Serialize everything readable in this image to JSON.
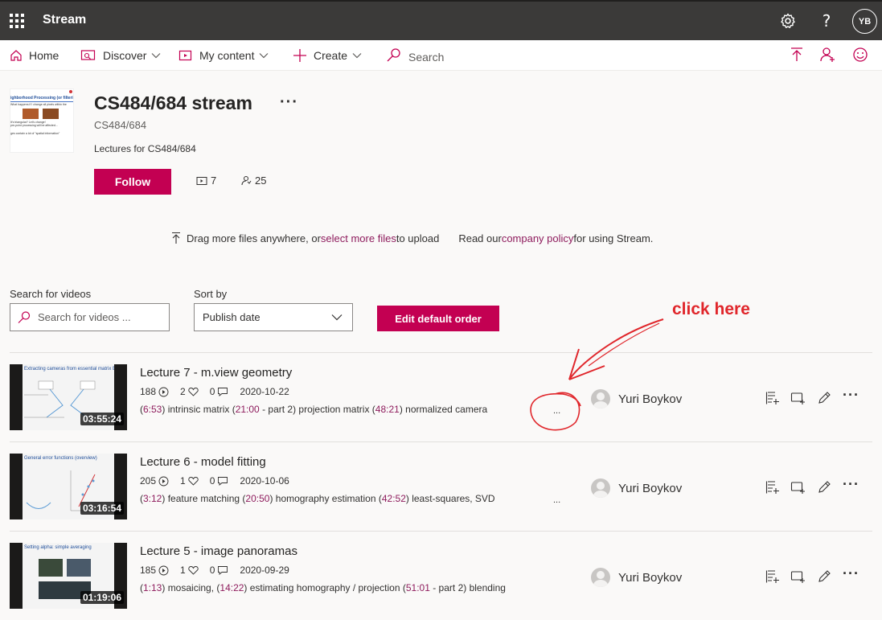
{
  "app": {
    "name": "Stream",
    "user_initials": "YB"
  },
  "nav": {
    "home": "Home",
    "discover": "Discover",
    "my_content": "My content",
    "create": "Create",
    "search": "Search"
  },
  "channel": {
    "title": "CS484/684 stream",
    "more": "···",
    "subtitle": "CS484/684",
    "description": "Lectures for CS484/684",
    "follow_label": "Follow",
    "video_count": "7",
    "follower_count": "25",
    "thumb_heading": "ighborhood Processing (or filtering)",
    "thumb_lines": [
      "What happens if I change all pixels within the",
      "It's triangular? Let's change!",
      "pre-point processing will be affected...",
      "ges contain a lot of \"spatial information\""
    ]
  },
  "upload": {
    "text1": "Drag more files anywhere, or ",
    "link1": "select more files",
    "text2": " to upload",
    "text3": "Read our ",
    "link2": "company policy",
    "text4": " for using Stream."
  },
  "controls": {
    "search_label": "Search for videos",
    "search_placeholder": "Search for videos ...",
    "sort_label": "Sort by",
    "sort_value": "Publish date",
    "edit_order_label": "Edit default order"
  },
  "annotation": {
    "text": "click here"
  },
  "videos": [
    {
      "title": "Lecture 7 - m.view geometry",
      "views": "188",
      "likes": "2",
      "comments": "0",
      "date": "2020-10-22",
      "duration": "03:55:24",
      "desc": [
        {
          "t": "(",
          "ts": false
        },
        {
          "t": "6:53",
          "ts": true
        },
        {
          "t": ") intrinsic matrix (",
          "ts": false
        },
        {
          "t": "21:00",
          "ts": true
        },
        {
          "t": " - part 2) projection matrix (",
          "ts": false
        },
        {
          "t": "48:21",
          "ts": true
        },
        {
          "t": ") normalized camera",
          "ts": false
        }
      ],
      "owner": "Yuri Boykov",
      "slide_title": "Extracting cameras from essential matrix E"
    },
    {
      "title": "Lecture 6 - model fitting",
      "views": "205",
      "likes": "1",
      "comments": "0",
      "date": "2020-10-06",
      "duration": "03:16:54",
      "desc": [
        {
          "t": "(",
          "ts": false
        },
        {
          "t": "3:12",
          "ts": true
        },
        {
          "t": ") feature matching (",
          "ts": false
        },
        {
          "t": "20:50",
          "ts": true
        },
        {
          "t": ") homography estimation (",
          "ts": false
        },
        {
          "t": "42:52",
          "ts": true
        },
        {
          "t": ") least-squares, SVD",
          "ts": false
        }
      ],
      "owner": "Yuri Boykov",
      "slide_title": "General error functions (overview)"
    },
    {
      "title": "Lecture 5 - image panoramas",
      "views": "185",
      "likes": "1",
      "comments": "0",
      "date": "2020-09-29",
      "duration": "01:19:06",
      "desc": [
        {
          "t": "(",
          "ts": false
        },
        {
          "t": "1:13",
          "ts": true
        },
        {
          "t": ") mosaicing, (",
          "ts": false
        },
        {
          "t": "14:22",
          "ts": true
        },
        {
          "t": ") estimating homography / projection (",
          "ts": false
        },
        {
          "t": "51:01",
          "ts": true
        },
        {
          "t": " - part 2) blending",
          "ts": false
        }
      ],
      "owner": "Yuri Boykov",
      "slide_title": "Setting alpha: simple averaging"
    }
  ],
  "icons": {
    "settings": "gear-icon",
    "help": "help-icon",
    "upload": "upload-icon",
    "invite": "add-person-icon",
    "feedback": "smiley-icon"
  },
  "colors": {
    "accent": "#c30052",
    "topbar": "#3b3a39",
    "annotation": "#e0262b",
    "link": "#8e1c5d"
  }
}
